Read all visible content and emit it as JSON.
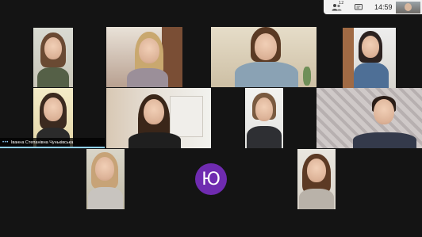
{
  "status_bar": {
    "participants_count": "12",
    "clock": "14:59",
    "icons": [
      "participants-icon",
      "chat-icon"
    ]
  },
  "active_speaker": {
    "name": "Іванна Степанівна Чуньківська"
  },
  "no_video_participant": {
    "avatar_initial": "Ю",
    "avatar_color": "#6f2bb0"
  },
  "accent_color": "#8fd1ff"
}
